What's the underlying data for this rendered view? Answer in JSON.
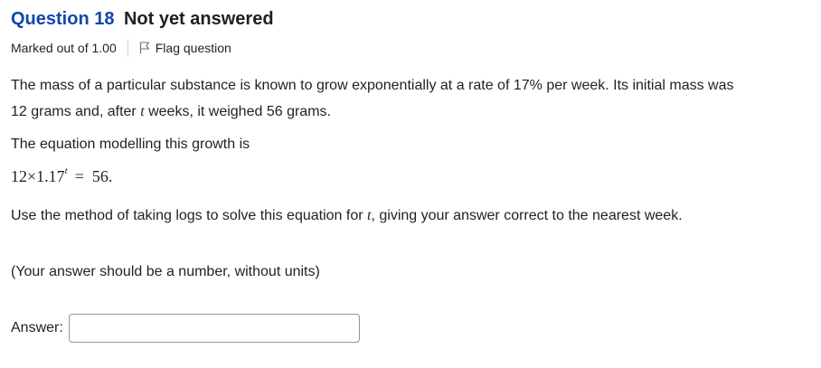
{
  "question": {
    "label": "Question 18",
    "state": "Not yet answered",
    "marks": "Marked out of 1.00",
    "flag_label": "Flag question"
  },
  "content": {
    "para1_a": "The mass of a particular substance is known to grow exponentially at a rate of 17% per week. Its initial mass was 12 grams and, after ",
    "para1_var": "t",
    "para1_b": " weeks, it weighed 56 grams.",
    "para2": "The equation modelling this growth is",
    "equation_base": "12×1.17",
    "equation_exp": "t",
    "equation_eq": "=",
    "equation_rhs": "56.",
    "para3_a": "Use the method of taking logs to solve this equation for ",
    "para3_var": "t",
    "para3_b": ", giving your answer correct to the nearest week.",
    "para4": "(Your answer should be a number, without units)"
  },
  "answer": {
    "label": "Answer:",
    "value": "",
    "placeholder": ""
  },
  "colors": {
    "question_number": "#0f47ad",
    "text": "#1d2125",
    "input_border": "#8f959e"
  },
  "icons": {
    "flag": "flag-outline-icon"
  }
}
